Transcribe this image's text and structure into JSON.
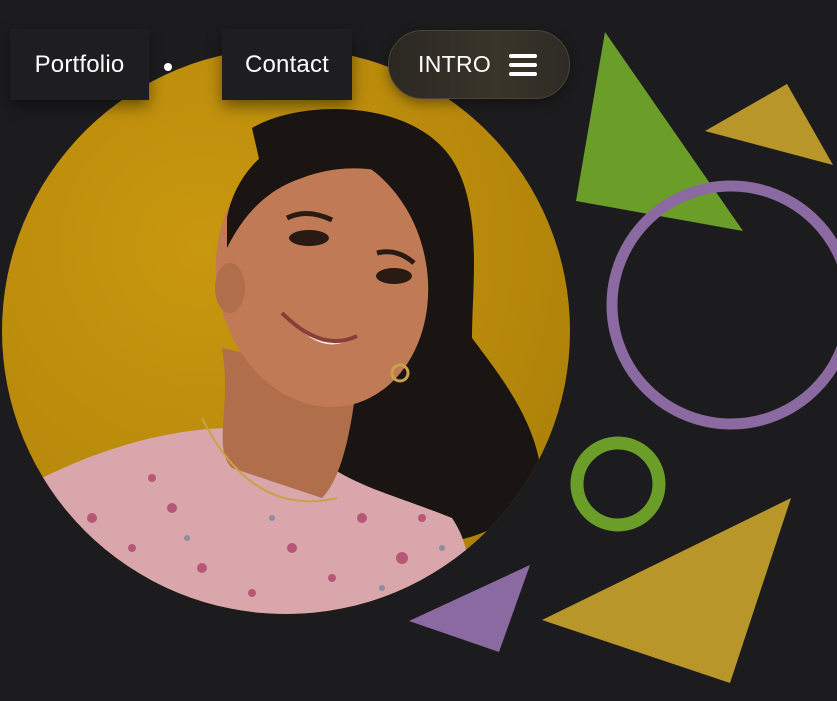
{
  "nav": {
    "portfolio_label": "Portfolio",
    "contact_label": "Contact",
    "intro_label": "INTRO",
    "menu_icon": "hamburger-menu-icon"
  },
  "colors": {
    "background": "#1c1c1e",
    "portrait_bg": "#b8890b",
    "green": "#6b9e28",
    "gold": "#b8962a",
    "purple": "#8a6aa0"
  },
  "portrait": {
    "subject": "profile-photo"
  }
}
